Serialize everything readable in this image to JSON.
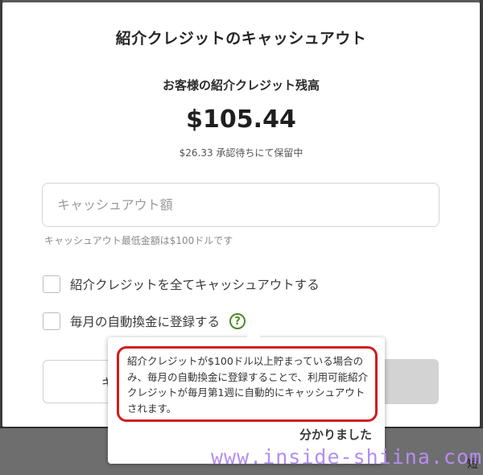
{
  "modal": {
    "title": "紹介クレジットのキャッシュアウト",
    "balance_label": "お客様の紹介クレジット残高",
    "balance_amount": "$105.44",
    "pending_note": "$26.33 承認待ちにて保留中",
    "cashout_input": {
      "placeholder": "キャッシュアウト額",
      "value": ""
    },
    "input_hint": "キャッシュアウト最低金額は$100ドルです",
    "options": [
      {
        "label": "紹介クレジットを全てキャッシュアウトする",
        "checked": false
      },
      {
        "label": "毎月の自動換金に登録する",
        "checked": false
      }
    ],
    "help_icon_text": "?",
    "left_button_fragment": "キ"
  },
  "tooltip": {
    "text": "紹介クレジットが$100ドル以上貯まっている場合のみ、毎月の自動換金に登録することで、利用可能紹介クレジットが毎月第1週に自動的にキャッシュアウトされます。",
    "ok_label": "分かりました",
    "highlight_color": "#cf1d1d"
  },
  "background": {
    "corner_fragment": "短"
  },
  "watermark": "www.inside-shiina.com",
  "colors": {
    "help_icon": "#4a8a26",
    "watermark": "#b58ef0"
  }
}
